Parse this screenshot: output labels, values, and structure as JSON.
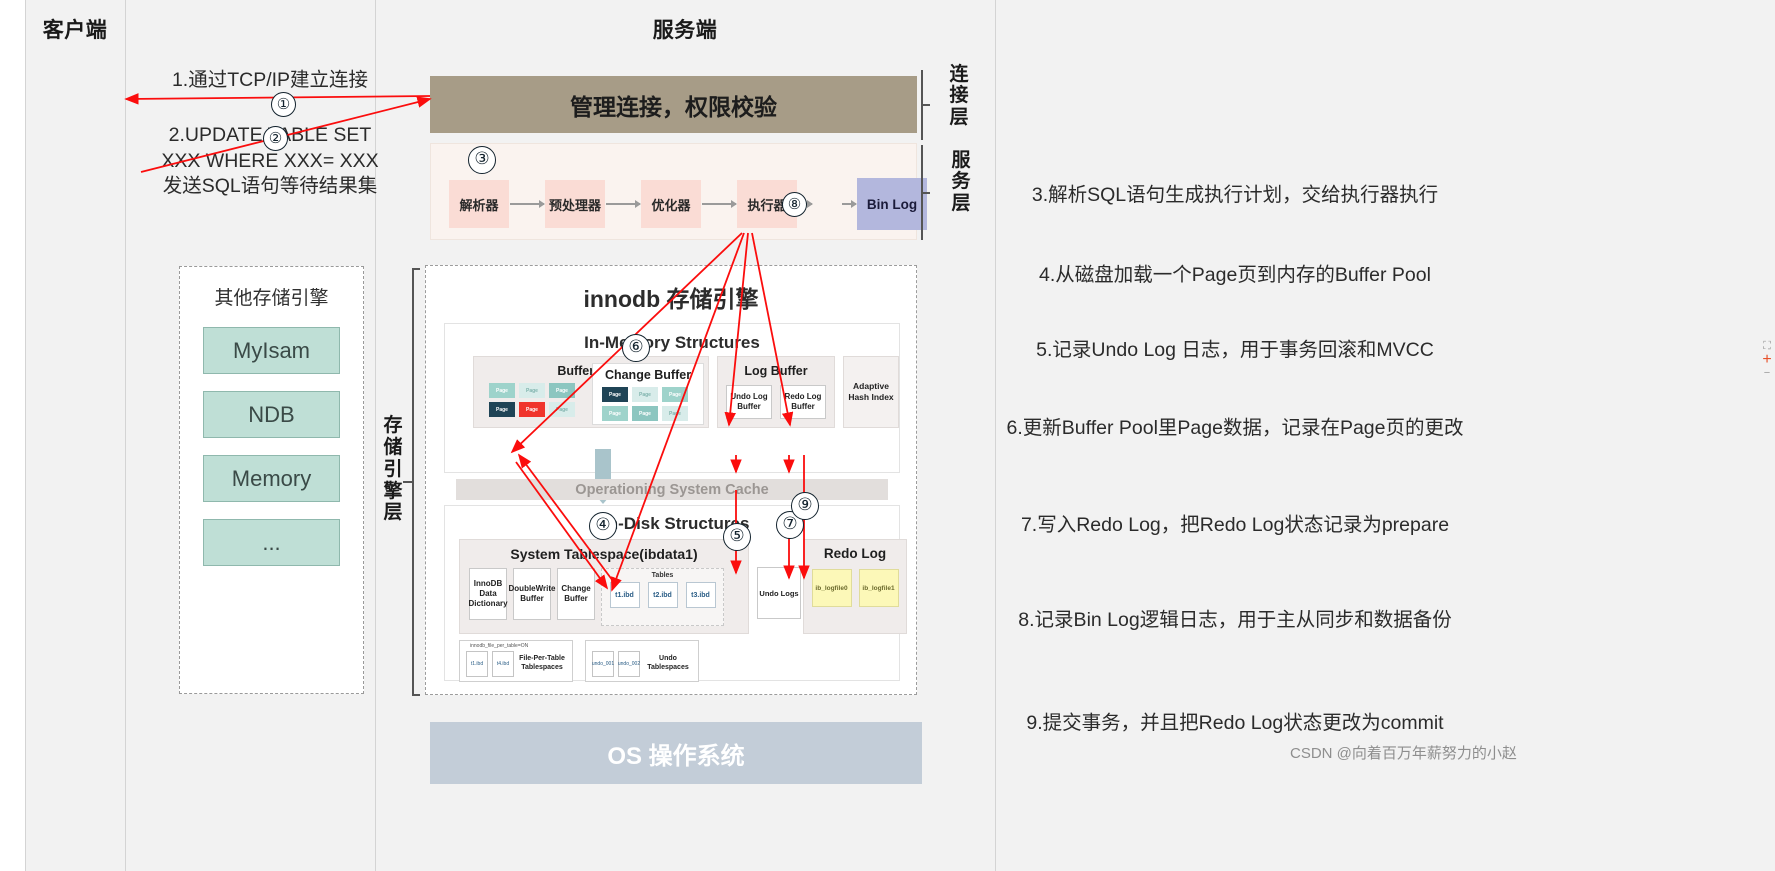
{
  "columns": {
    "client_header": "客户端",
    "server_header": "服务端"
  },
  "client_steps": [
    {
      "id": "step1",
      "text": "1.通过TCP/IP建立连接"
    },
    {
      "id": "step2",
      "text": "2.UPDATE TABLE SET\nXXX WHERE XXX= XXX\n发送SQL语句等待结果集"
    }
  ],
  "circles": {
    "c1": "①",
    "c2": "②",
    "c3": "③",
    "c4": "④",
    "c5": "⑤",
    "c6": "⑥",
    "c7": "⑦",
    "c8": "⑧",
    "c9": "⑨"
  },
  "connection_bar": {
    "label": "管理连接，权限校验"
  },
  "service_pipeline": {
    "boxes": [
      "解析器",
      "预处理器",
      "优化器",
      "执行器"
    ],
    "binlog": "Bin Log"
  },
  "layers": {
    "connection_layer": "连接层",
    "service_layer": "服务层",
    "storage_layer": "存储引擎层"
  },
  "other_engines": {
    "title": "其他存储引擎",
    "items": [
      "MyIsam",
      "NDB",
      "Memory",
      "..."
    ]
  },
  "innodb": {
    "title": "innodb 存储引擎",
    "in_memory": {
      "title": "In-Memory Structures",
      "buffer_pool": {
        "title": "Buffer Pool",
        "pages": [
          "Page",
          "Page",
          "Page",
          "Page",
          "Page",
          "Page"
        ]
      },
      "change_buffer": {
        "title": "Change Buffer",
        "pages": [
          "Page",
          "Page",
          "Page",
          "Page",
          "Page",
          "Page"
        ]
      },
      "log_buffer": {
        "title": "Log Buffer",
        "items": [
          "Undo Log Buffer",
          "Redo Log Buffer"
        ]
      },
      "adaptive_hash_index": "Adaptive Hash Index"
    },
    "os_cache": "Operationing System Cache",
    "on_disk": {
      "title": "On-Disk Structures",
      "system_tablespace": {
        "title": "System Tablespace(ibdata1)",
        "items": [
          "InnoDB Data Dictionary",
          "DoubleWrite Buffer",
          "Change Buffer"
        ],
        "tables_caption": "Tables",
        "tables": [
          "t1.ibd",
          "t2.ibd",
          "t3.ibd"
        ]
      },
      "undo_logs": "Undo Logs",
      "redo_log": {
        "title": "Redo Log",
        "files": [
          "ib_logfile0",
          "ib_logfile1"
        ]
      },
      "file_per_table": {
        "caption": "innodb_file_per_table=ON",
        "files": [
          "t1.ibd",
          "t4.ibd"
        ],
        "label": "File-Per-Table Tablespaces"
      },
      "undo_tablespaces": {
        "files": [
          "undo_001",
          "undo_002"
        ],
        "label": "Undo Tablespaces"
      }
    }
  },
  "os_bar": {
    "label": "OS 操作系统"
  },
  "notes": [
    {
      "id": "n3",
      "text": "3.解析SQL语句生成执行计划，交给执行器执行"
    },
    {
      "id": "n4",
      "text": "4.从磁盘加载一个Page页到内存的Buffer Pool"
    },
    {
      "id": "n5",
      "text": "5.记录Undo Log 日志，用于事务回滚和MVCC"
    },
    {
      "id": "n6",
      "text": "6.更新Buffer Pool里Page数据，记录在Page页的更改"
    },
    {
      "id": "n7",
      "text": "7.写入Redo Log，把Redo Log状态记录为prepare"
    },
    {
      "id": "n8",
      "text": "8.记录Bin Log逻辑日志，用于主从同步和数据备份"
    },
    {
      "id": "n9",
      "text": "9.提交事务，并且把Redo Log状态更改为commit"
    }
  ],
  "watermark": "CSDN @向着百万年薪努力的小赵",
  "colors": {
    "band_gray": "#f2f2f2",
    "conn_bar": "#a79c87",
    "pipeline_box": "#fadcd5",
    "binlog": "#b3b7dd",
    "engine_box": "#bfdfd6",
    "os_bar": "#c3cdd8",
    "arrow_red": "#fb0d0d",
    "redo_file": "#fcf8b8"
  },
  "edge_widget": {
    "top": "⛶",
    "plus": "+",
    "minus": "−"
  }
}
